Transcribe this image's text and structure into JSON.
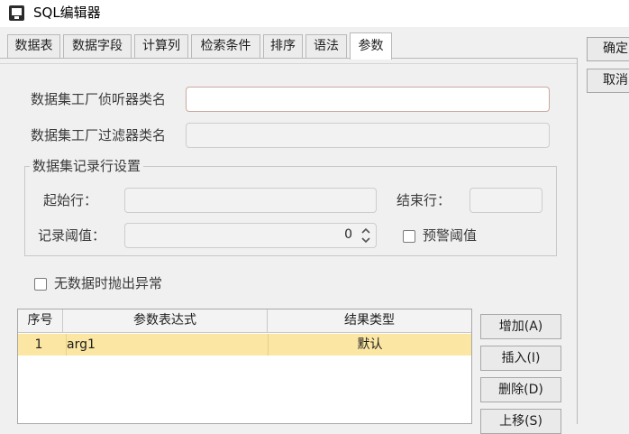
{
  "window": {
    "title": "SQL编辑器"
  },
  "tabs": [
    {
      "label": "数据表"
    },
    {
      "label": "数据字段"
    },
    {
      "label": "计算列"
    },
    {
      "label": "检索条件"
    },
    {
      "label": "排序"
    },
    {
      "label": "语法"
    },
    {
      "label": "参数",
      "active": true
    }
  ],
  "side_buttons": {
    "ok": "确定",
    "cancel": "取消"
  },
  "form": {
    "listener_label": "数据集工厂侦听器类名",
    "listener_value": "",
    "filter_label": "数据集工厂过滤器类名",
    "filter_value": "",
    "group_title": "数据集记录行设置",
    "start_row_label": "起始行：",
    "start_row_value": "",
    "end_row_label": "结束行：",
    "end_row_value": "",
    "threshold_label": "记录阈值：",
    "threshold_value": "0",
    "warn_threshold_label": "预警阈值",
    "warn_threshold_checked": false,
    "throw_on_empty_label": "无数据时抛出异常",
    "throw_on_empty_checked": false
  },
  "param_table": {
    "columns": [
      "序号",
      "参数表达式",
      "结果类型"
    ],
    "rows": [
      {
        "index": "1",
        "expression": "arg1",
        "type": "默认",
        "selected": true
      }
    ]
  },
  "table_buttons": {
    "add": "增加(A)",
    "insert": "插入(I)",
    "delete": "删除(D)",
    "move_up": "上移(S)"
  },
  "colors": {
    "selected_row": "#fbe7a3",
    "focus_border": "#c9a9a0"
  },
  "icons": [
    "app-icon",
    "spinner-up-icon",
    "spinner-down-icon"
  ]
}
